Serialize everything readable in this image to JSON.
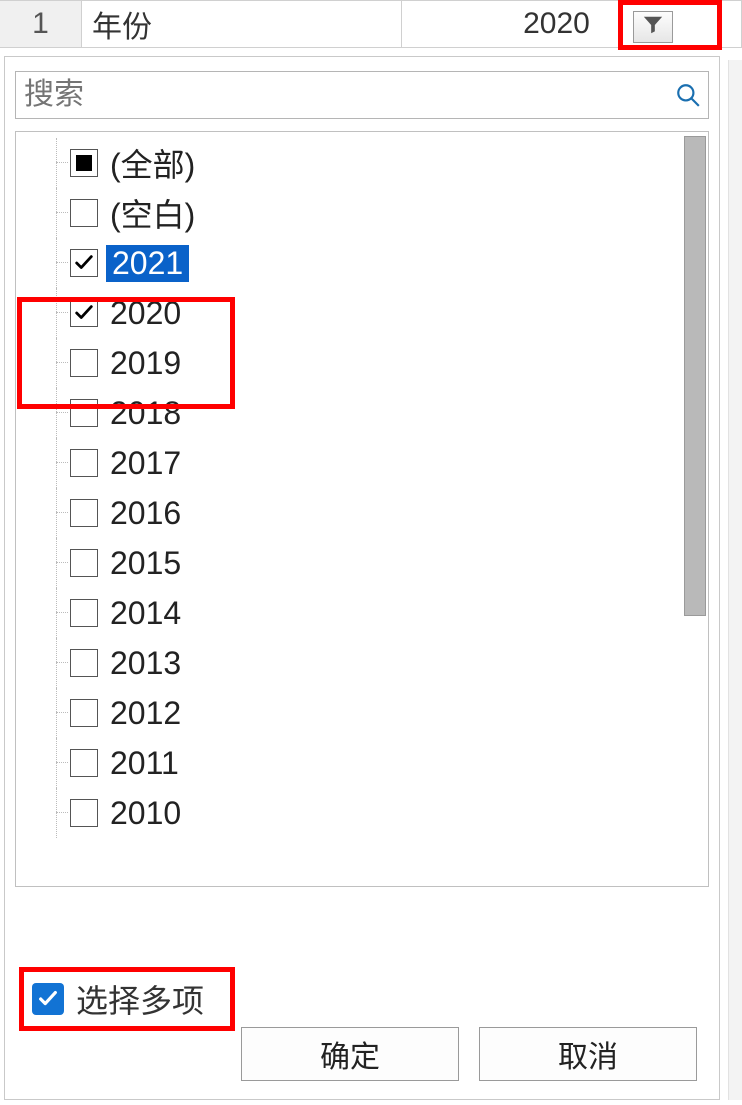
{
  "header": {
    "row_number": "1",
    "field_label": "年份",
    "field_value": "2020"
  },
  "search": {
    "placeholder": "搜索"
  },
  "tree": {
    "all_label": "(全部)",
    "blank_label": "(空白)",
    "items": [
      {
        "label": "2021",
        "checked": true,
        "selected": true
      },
      {
        "label": "2020",
        "checked": true,
        "selected": false
      },
      {
        "label": "2019",
        "checked": false,
        "selected": false
      },
      {
        "label": "2018",
        "checked": false,
        "selected": false
      },
      {
        "label": "2017",
        "checked": false,
        "selected": false
      },
      {
        "label": "2016",
        "checked": false,
        "selected": false
      },
      {
        "label": "2015",
        "checked": false,
        "selected": false
      },
      {
        "label": "2014",
        "checked": false,
        "selected": false
      },
      {
        "label": "2013",
        "checked": false,
        "selected": false
      },
      {
        "label": "2012",
        "checked": false,
        "selected": false
      },
      {
        "label": "2011",
        "checked": false,
        "selected": false
      },
      {
        "label": "2010",
        "checked": false,
        "selected": false
      }
    ]
  },
  "multi_select": {
    "label": "选择多项",
    "checked": true
  },
  "buttons": {
    "ok": "确定",
    "cancel": "取消"
  }
}
